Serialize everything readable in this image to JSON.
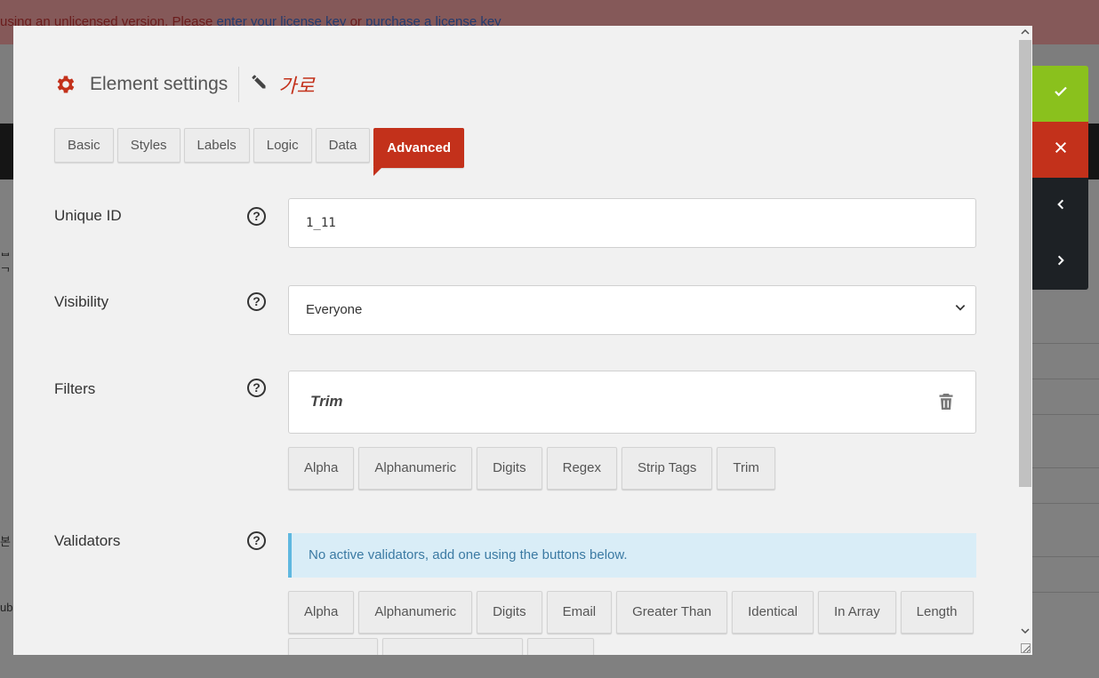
{
  "background": {
    "notice_text": "using an unlicensed version. Please ",
    "notice_link1": "enter your license key",
    "notice_mid": " or ",
    "notice_link2": "purchase a license key",
    "left_frag_1": "ᆸ",
    "left_frag_2": "ᄀ",
    "left_frag_3": "본 프",
    "left_frag_4": "ub"
  },
  "modal": {
    "title": "Element settings",
    "element_name": "가로",
    "tabs": [
      {
        "label": "Basic"
      },
      {
        "label": "Styles"
      },
      {
        "label": "Labels"
      },
      {
        "label": "Logic"
      },
      {
        "label": "Data"
      },
      {
        "label": "Advanced"
      }
    ],
    "active_tab": "Advanced",
    "help_glyph": "?",
    "fields": {
      "unique_id": {
        "label": "Unique ID",
        "value": "1_11"
      },
      "visibility": {
        "label": "Visibility",
        "value": "Everyone"
      },
      "filters": {
        "label": "Filters",
        "active": [
          "Trim"
        ],
        "buttons": [
          "Alpha",
          "Alphanumeric",
          "Digits",
          "Regex",
          "Strip Tags",
          "Trim"
        ]
      },
      "validators": {
        "label": "Validators",
        "notice": "No active validators, add one using the buttons below.",
        "buttons": [
          "Alpha",
          "Alphanumeric",
          "Digits",
          "Email",
          "Greater Than",
          "Identical",
          "In Array",
          "Length"
        ]
      }
    }
  },
  "side_controls": {
    "ok_icon": "check-icon",
    "cancel_icon": "close-icon",
    "prev_icon": "chevron-left-icon",
    "next_icon": "chevron-right-icon",
    "ok_color": "#8ac11d",
    "cancel_color": "#c3311b",
    "nav_color": "#1d2125"
  },
  "colors": {
    "accent": "#c3311b",
    "info_bg": "#d9edf7",
    "info_text": "#3b7aa3"
  }
}
